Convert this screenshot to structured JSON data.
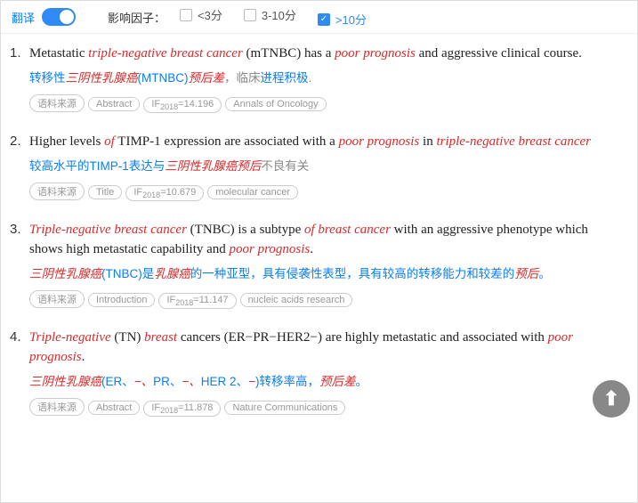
{
  "topbar": {
    "translate_label": "翻译",
    "factor_label": "影响因子：",
    "options": [
      {
        "label": "<3分",
        "checked": false
      },
      {
        "label": "3-10分",
        "checked": false
      },
      {
        "label": ">10分",
        "checked": true
      }
    ]
  },
  "tag_source_label": "语料来源",
  "if_prefix": "IF",
  "if_year": "2018",
  "results": [
    {
      "num": "1.",
      "en_parts": [
        {
          "t": "Metastatic ",
          "e": false
        },
        {
          "t": "triple-negative breast cancer",
          "e": true
        },
        {
          "t": " (mTNBC) has a ",
          "e": false
        },
        {
          "t": "poor prognosis",
          "e": true
        },
        {
          "t": " and aggressive clinical course.",
          "e": false
        }
      ],
      "cn_parts": [
        {
          "t": "转移性",
          "c": "blue"
        },
        {
          "t": "三阴性乳腺癌",
          "c": "hl"
        },
        {
          "t": "(MTNBC)",
          "c": "blue"
        },
        {
          "t": "预后差",
          "c": "hl"
        },
        {
          "t": "，临床",
          "c": "gray"
        },
        {
          "t": "进程积极",
          "c": "blue"
        },
        {
          "t": ".",
          "c": "gray"
        }
      ],
      "section": "Abstract",
      "if": "=14.196",
      "journal": "Annals of Oncology"
    },
    {
      "num": "2.",
      "en_parts": [
        {
          "t": "Higher levels ",
          "e": false
        },
        {
          "t": "of",
          "e": true
        },
        {
          "t": " TIMP-1 expression are associated with a ",
          "e": false
        },
        {
          "t": "poor prognosis",
          "e": true
        },
        {
          "t": " in ",
          "e": false
        },
        {
          "t": "triple-negative breast cancer",
          "e": true
        }
      ],
      "cn_parts": [
        {
          "t": "较高水平的TIMP-1表达与",
          "c": "blue"
        },
        {
          "t": "三阴性乳腺癌预后",
          "c": "hl"
        },
        {
          "t": "不良有关",
          "c": "gray"
        }
      ],
      "section": "Title",
      "if": "=10.679",
      "journal": "molecular cancer"
    },
    {
      "num": "3.",
      "en_parts": [
        {
          "t": "Triple-negative breast cancer",
          "e": true
        },
        {
          "t": " (TNBC) is a subtype ",
          "e": false
        },
        {
          "t": "of breast cancer",
          "e": true
        },
        {
          "t": " with an aggressive phenotype which shows high metastatic capability and ",
          "e": false
        },
        {
          "t": "poor prognosis",
          "e": true
        },
        {
          "t": ".",
          "e": false
        }
      ],
      "cn_parts": [
        {
          "t": "三阴性乳腺癌",
          "c": "hl"
        },
        {
          "t": "(TNBC)是",
          "c": "blue"
        },
        {
          "t": "乳腺癌",
          "c": "hl"
        },
        {
          "t": "的一种亚型，具有侵袭性表型，具有较高的转移能力和较差的",
          "c": "blue"
        },
        {
          "t": "预后",
          "c": "hl"
        },
        {
          "t": "。",
          "c": "blue"
        }
      ],
      "section": "Introduction",
      "if": "=11.147",
      "journal": "nucleic acids research"
    },
    {
      "num": "4.",
      "en_parts": [
        {
          "t": "Triple-negative",
          "e": true
        },
        {
          "t": " (TN) ",
          "e": false
        },
        {
          "t": "breast",
          "e": true
        },
        {
          "t": " cancers (ER−PR−HER2−) are highly metastatic and associated with ",
          "e": false
        },
        {
          "t": "poor prognosis",
          "e": true
        },
        {
          "t": ".",
          "e": false
        }
      ],
      "cn_parts": [
        {
          "t": "三阴性乳腺癌",
          "c": "hl"
        },
        {
          "t": "(ER、",
          "c": "blue"
        },
        {
          "t": "−、",
          "c": "hl"
        },
        {
          "t": "PR、",
          "c": "blue"
        },
        {
          "t": "−、",
          "c": "hl"
        },
        {
          "t": "HER 2、",
          "c": "blue"
        },
        {
          "t": "−",
          "c": "hl"
        },
        {
          "t": ")转移率高，",
          "c": "blue"
        },
        {
          "t": "预后差",
          "c": "hl"
        },
        {
          "t": "。",
          "c": "blue"
        }
      ],
      "section": "Abstract",
      "if": "=11.878",
      "journal": "Nature Communications"
    }
  ]
}
